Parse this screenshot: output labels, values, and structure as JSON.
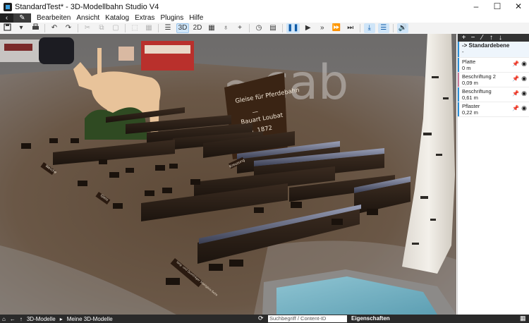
{
  "window": {
    "title": "StandardTest* - 3D-Modellbahn Studio V4",
    "controls": [
      "–",
      "☐",
      "✕"
    ]
  },
  "menu": {
    "nav_back": "‹",
    "edit": "✎",
    "items": [
      "Bearbeiten",
      "Ansicht",
      "Katalog",
      "Extras",
      "Plugins",
      "Hilfe"
    ]
  },
  "toolbar": {
    "view_3d": "3D",
    "view_2d": "2D"
  },
  "scene": {
    "sign_lines": [
      "Gleise für Pferdebahn",
      "—",
      "Bauart Loubat",
      "ca. 1872"
    ],
    "watermark": "~cab",
    "small_labels": [
      "Weiche",
      "Gleis",
      "Kreuzung",
      "lang- und Querträger Stahlgleis-Seite"
    ]
  },
  "layers_panel": {
    "header_icons": [
      "+",
      "−",
      "⁄",
      "↑",
      "↓"
    ],
    "layers": [
      {
        "name": "-> Standardebene",
        "value": "-"
      },
      {
        "name": "Platte",
        "value": "0 m"
      },
      {
        "name": "Beschriftung 2",
        "value": "0,09 m"
      },
      {
        "name": "Beschriftung",
        "value": "0,61 m"
      },
      {
        "name": "Pflaster",
        "value": "0,22 m"
      }
    ]
  },
  "statusbar": {
    "home": "⌂",
    "back": "←",
    "up": "↑",
    "breadcrumb_1": "3D-Modelle",
    "arrow": "▸",
    "breadcrumb_2": "Meine 3D-Modelle",
    "search_placeholder": "Suchbegriff / Content-ID",
    "properties": "Eigenschaften"
  },
  "colors": {
    "accent": "#2d8fd5",
    "statusbar": "#2a2a2a",
    "sign": "#3a2414"
  }
}
